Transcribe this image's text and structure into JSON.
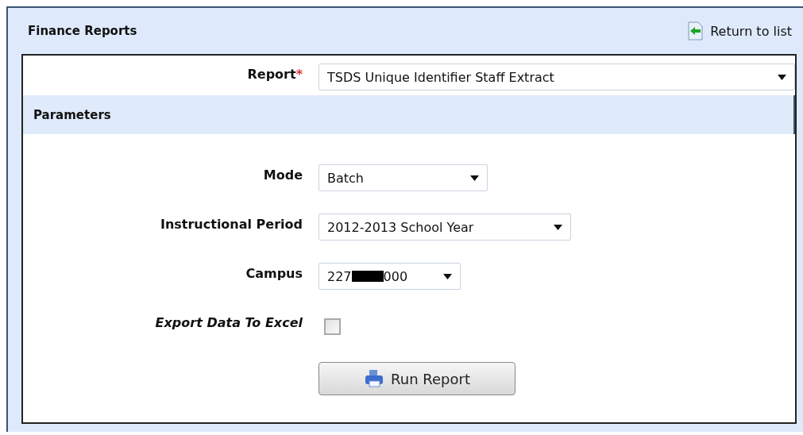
{
  "panel": {
    "title": "Finance Reports",
    "return_link": "Return to list"
  },
  "report": {
    "label": "Report",
    "required_mark": "*",
    "value": "TSDS Unique Identifier Staff Extract"
  },
  "parameters": {
    "title": "Parameters",
    "fields": [
      {
        "kind": "select",
        "label": "Mode",
        "value": "Batch",
        "italic": false
      },
      {
        "kind": "select",
        "label": "Instructional Period",
        "value": "2012-2013 School Year",
        "italic": false
      },
      {
        "kind": "redacted-select",
        "label": "Campus",
        "value_start": "227",
        "value_end": "000",
        "italic": false
      },
      {
        "kind": "checkbox",
        "label": "Export Data To Excel",
        "checked": false,
        "italic": true
      }
    ]
  },
  "run_button": "Run Report"
}
